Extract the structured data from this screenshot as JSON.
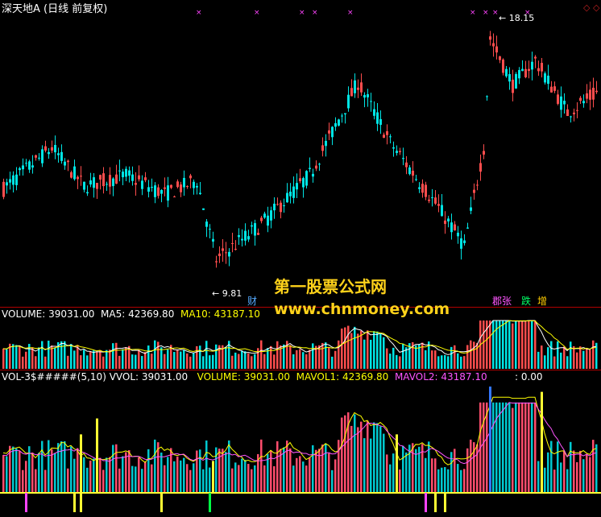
{
  "title": "深天地A (日线 前复权)",
  "price": {
    "high_label": "18.15",
    "low_label": "9.81",
    "high_index": 152,
    "low_index": 66,
    "ylim": [
      8.5,
      19.0
    ],
    "up_color": "#ff4d4d",
    "down_color": "#00e5e5",
    "annotations": [
      {
        "text": "财",
        "color": "#55aaff",
        "index": 76
      },
      {
        "text": "郡张",
        "color": "#ff55ff",
        "index": 152
      },
      {
        "text": "跌",
        "color": "#00ff66",
        "index": 161
      },
      {
        "text": "增",
        "color": "#ffcc00",
        "index": 166
      }
    ]
  },
  "volume": {
    "label_volume": "VOLUME: 39031.00",
    "label_ma5": "MA5: 42369.80",
    "label_ma10": "MA10: 43187.10",
    "ma5_color": "#ffffff",
    "ma10_color": "#ffff00"
  },
  "indicator": {
    "label_name": "VOL-3$#####(5,10)",
    "label_vvol": "VVOL: 39031.00",
    "label_volume": "VOLUME: 39031.00",
    "label_mavol1": "MAVOL1: 42369.80",
    "label_mavol2": "MAVOL2: 43187.10",
    "label_zero": ": 0.00",
    "mavol1_color": "#ffff00",
    "mavol2_color": "#ff55ff"
  },
  "watermark": {
    "line1": "第一股票公式网",
    "line2": "www.chnmoney.com"
  },
  "toolbar": {
    "up_icon": "up-arrow-icon",
    "diamond_icon": "diamond-icon"
  }
}
